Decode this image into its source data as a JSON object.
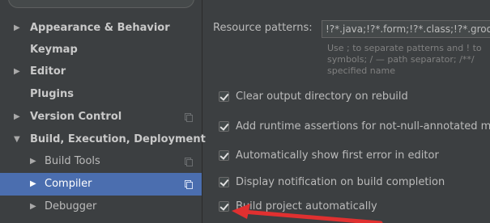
{
  "sidebar": {
    "items": [
      {
        "label": "Appearance & Behavior",
        "arrow": "▶"
      },
      {
        "label": "Keymap",
        "arrow": ""
      },
      {
        "label": "Editor",
        "arrow": "▶"
      },
      {
        "label": "Plugins",
        "arrow": ""
      },
      {
        "label": "Version Control",
        "arrow": "▶"
      },
      {
        "label": "Build, Execution, Deployment",
        "arrow": "▼"
      },
      {
        "label": "Build Tools",
        "arrow": "▶"
      },
      {
        "label": "Compiler",
        "arrow": "▶"
      },
      {
        "label": "Debugger",
        "arrow": "▶"
      }
    ],
    "selected_label": "Compiler"
  },
  "main": {
    "resource_patterns_label": "Resource patterns:",
    "resource_patterns_value": "!?*.java;!?*.form;!?*.class;!?*.groovy",
    "hint_text": "Use ; to separate patterns and ! to\nsymbols; / — path separator; /**/\nspecified name",
    "options": [
      {
        "label": "Clear output directory on rebuild",
        "checked": true
      },
      {
        "label": "Add runtime assertions for not-null-annotated m",
        "checked": true
      },
      {
        "label": "Automatically show first error in editor",
        "checked": true
      },
      {
        "label": "Display notification on build completion",
        "checked": true
      },
      {
        "label": "Build project automatically",
        "checked": true
      }
    ]
  },
  "annotation": {
    "color": "#e03030"
  },
  "colors": {
    "selection": "#4b6eaf",
    "background": "#3c3f41"
  }
}
